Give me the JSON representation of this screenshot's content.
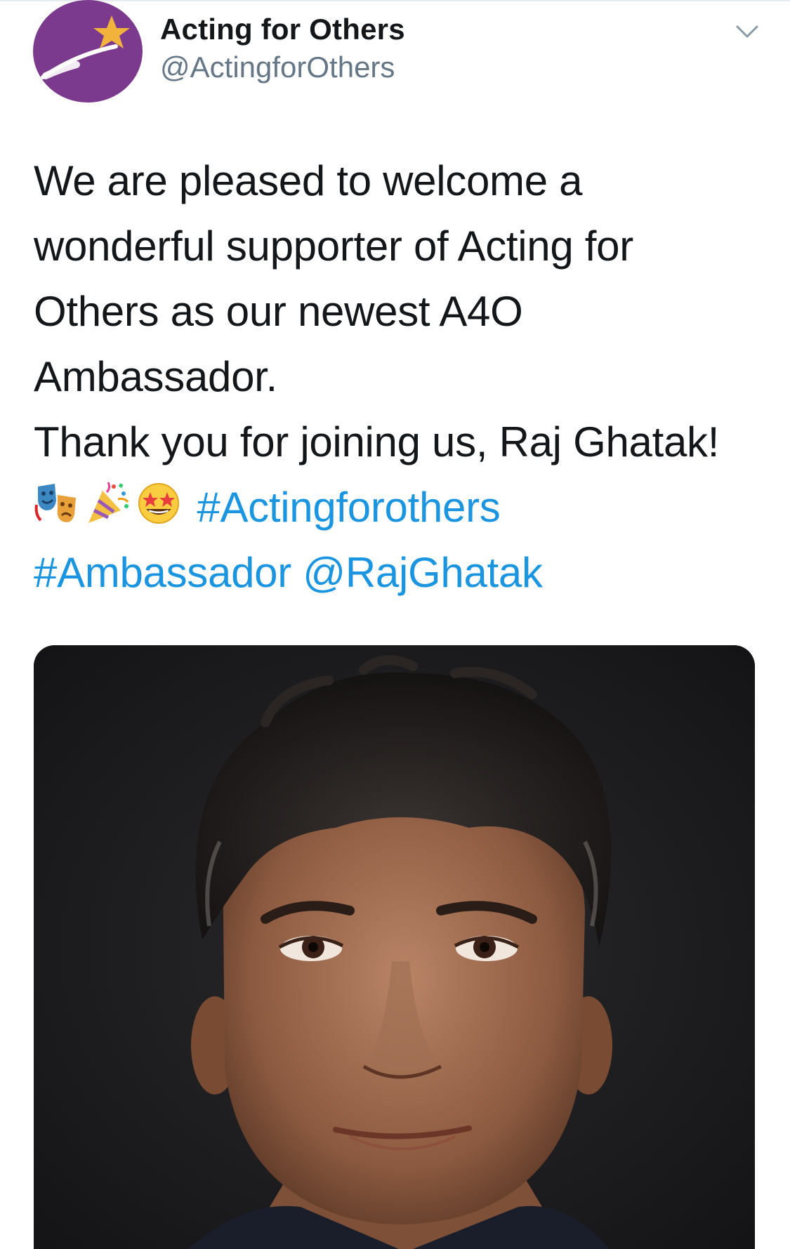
{
  "author": {
    "name": "Acting for Others",
    "handle": "@ActingforOthers",
    "avatar_color": "#7b3a8e",
    "avatar_star_color": "#f2b33d"
  },
  "menu": {
    "icon": "chevron-down-icon"
  },
  "tweet": {
    "lines": [
      "We are pleased to welcome a",
      "wonderful supporter of Acting for",
      "Others as our newest A4O",
      "Ambassador.",
      "Thank you for joining us, Raj Ghatak!"
    ],
    "emojis": [
      "performing-arts-icon",
      "party-popper-icon",
      "star-struck-icon"
    ],
    "hashtag_1": "#Actingforothers",
    "hashtag_2": "#Ambassador",
    "mention": "@RajGhatak",
    "link_color": "#1b95e0"
  },
  "media": {
    "type": "photo",
    "background_color": "#1d1c1f"
  }
}
